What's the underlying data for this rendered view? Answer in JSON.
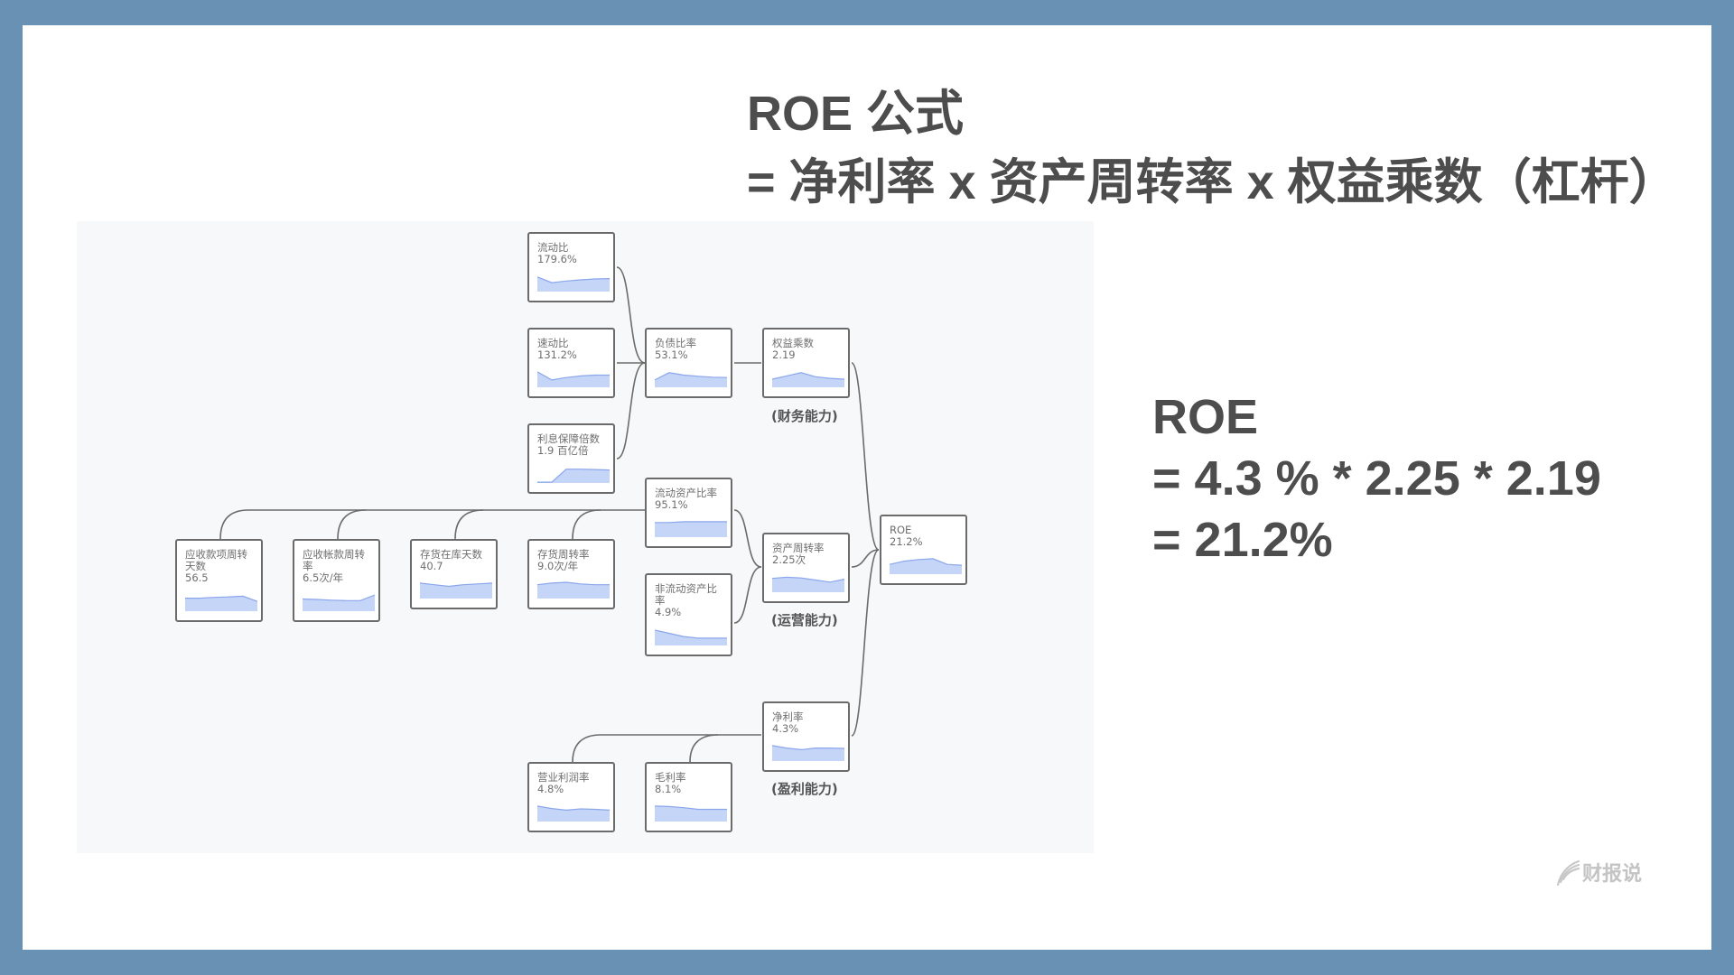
{
  "title": {
    "line1": "ROE 公式",
    "line2": "= 净利率 x 资产周转率 x 权益乘数（杠杆）"
  },
  "formula": {
    "line1": "ROE",
    "line2": "= 4.3 % * 2.25 * 2.19",
    "line3": "= 21.2%"
  },
  "logo": {
    "text": "财报说",
    "icon": "feather-stripes-icon"
  },
  "colors": {
    "frame": "#6991b4",
    "diagram_bg": "#f7f8fa",
    "spark_fill": "#c5d5f7",
    "spark_line": "#8aa6ec",
    "text": "#4d4d4d"
  },
  "group_labels": {
    "financial": "(财务能力)",
    "operating": "(运营能力)",
    "profit": "(盈利能力)"
  },
  "nodes": {
    "current_ratio": {
      "label": [
        "流动比"
      ],
      "value": "179.6%",
      "trend": [
        0.9,
        0.55,
        0.65,
        0.72,
        0.78,
        0.8
      ]
    },
    "quick_ratio": {
      "label": [
        "速动比"
      ],
      "value": "131.2%",
      "trend": [
        0.95,
        0.45,
        0.6,
        0.7,
        0.75,
        0.75
      ]
    },
    "interest_coverage": {
      "label": [
        "利息保障倍数"
      ],
      "value": "1.9 百亿倍",
      "trend": [
        0.05,
        0.05,
        0.85,
        0.85,
        0.83,
        0.8
      ]
    },
    "debt_ratio": {
      "label": [
        "负债比率"
      ],
      "value": "53.1%",
      "trend": [
        0.45,
        0.9,
        0.75,
        0.68,
        0.62,
        0.6
      ]
    },
    "equity_multiplier": {
      "label": [
        "权益乘数"
      ],
      "value": "2.19",
      "trend": [
        0.5,
        0.7,
        0.9,
        0.65,
        0.55,
        0.5
      ]
    },
    "current_asset_ratio": {
      "label": [
        "流动资产比率"
      ],
      "value": "95.1%",
      "trend": [
        0.9,
        0.9,
        0.95,
        0.95,
        0.95,
        0.95
      ]
    },
    "noncurrent_asset_ratio": {
      "label": [
        "非流动资产比",
        "率"
      ],
      "value": "4.9%",
      "trend": [
        0.95,
        0.75,
        0.55,
        0.45,
        0.45,
        0.45
      ]
    },
    "asset_turnover": {
      "label": [
        "资产周转率"
      ],
      "value": "2.25次",
      "trend": [
        0.85,
        0.92,
        0.88,
        0.75,
        0.62,
        0.8
      ]
    },
    "roe": {
      "label": [
        "ROE"
      ],
      "value": "21.2%",
      "trend": [
        0.6,
        0.8,
        0.9,
        0.95,
        0.6,
        0.55
      ]
    },
    "ar_days": {
      "label": [
        "应收款项周转",
        "天数"
      ],
      "value": "56.5",
      "trend": [
        0.8,
        0.8,
        0.85,
        0.88,
        0.92,
        0.6
      ]
    },
    "ar_turnover": {
      "label": [
        "应收帐款周转",
        "率"
      ],
      "value": "6.5次/年",
      "trend": [
        0.75,
        0.72,
        0.68,
        0.65,
        0.65,
        1.0
      ]
    },
    "inventory_days": {
      "label": [
        "存货在库天数"
      ],
      "value": "40.7",
      "trend": [
        0.95,
        0.85,
        0.75,
        0.85,
        0.9,
        0.95
      ]
    },
    "inventory_turnover": {
      "label": [
        "存货周转率"
      ],
      "value": "9.0次/年",
      "trend": [
        0.85,
        0.95,
        1.0,
        0.9,
        0.85,
        0.85
      ]
    },
    "net_margin": {
      "label": [
        "净利率"
      ],
      "value": "4.3%",
      "trend": [
        0.95,
        0.8,
        0.7,
        0.8,
        0.8,
        0.78
      ]
    },
    "operating_margin": {
      "label": [
        "营业利润率"
      ],
      "value": "4.8%",
      "trend": [
        0.95,
        0.8,
        0.7,
        0.78,
        0.75,
        0.7
      ]
    },
    "gross_margin": {
      "label": [
        "毛利率"
      ],
      "value": "8.1%",
      "trend": [
        0.95,
        0.92,
        0.85,
        0.75,
        0.75,
        0.75
      ]
    }
  }
}
